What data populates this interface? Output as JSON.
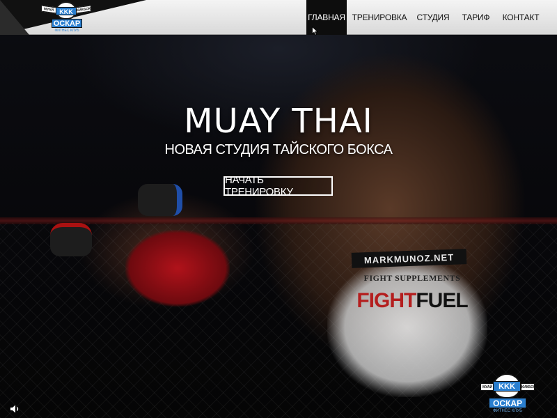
{
  "brand": {
    "logo_kkk": "KKK",
    "logo_name": "ОСКАР",
    "logo_wing_left": "МУАЙ ТАЙ",
    "logo_wing_right": "КИКБОКСИНГ",
    "logo_tagline": "ФИТНЕС КЛУБ",
    "accent": "#2a7fd0"
  },
  "nav": {
    "items": [
      {
        "label": "ГЛАВНАЯ",
        "active": true
      },
      {
        "label": "ТРЕНИРОВКА",
        "active": false
      },
      {
        "label": "СТУДИЯ",
        "active": false
      },
      {
        "label": "ТАРИФ",
        "active": false
      },
      {
        "label": "КОНТАКТ",
        "active": false
      }
    ],
    "active_bg": "#0d0d0d",
    "bar_bg": "#e6e6e6"
  },
  "hero": {
    "title": "MUAY THAI",
    "subtitle": "НОВАЯ СТУДИЯ ТАЙСКОГО БОКСА",
    "cta_label": "НАЧАТЬ ТРЕНИРОВКУ",
    "photo_text": {
      "shorts_band": "MARKMUNOZ.NET",
      "shorts_sponsor": "FIGHT SUPPLEMENTS",
      "shorts_brand_a": "FIGHT",
      "shorts_brand_b": "FUEL"
    }
  },
  "media": {
    "sound_icon": "speaker-icon"
  }
}
